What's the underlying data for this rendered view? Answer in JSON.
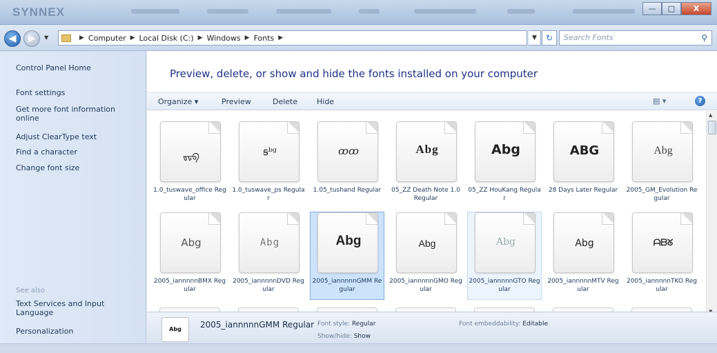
{
  "window": {
    "brand": "SYNNEX",
    "controls": {
      "minimize": "—",
      "maximize": "□",
      "close": "X"
    }
  },
  "nav": {
    "back_glyph": "◀",
    "forward_glyph": "▶",
    "breadcrumb": [
      "Computer",
      "Local Disk (C:)",
      "Windows",
      "Fonts"
    ],
    "search_placeholder": "Search Fonts"
  },
  "left_pane": {
    "links": [
      "Control Panel Home",
      "Font settings",
      "Get more font information online",
      "Adjust ClearType text",
      "Find a character",
      "Change font size"
    ],
    "see_also_heading": "See also",
    "see_also": [
      "Text Services and Input Language",
      "Personalization"
    ]
  },
  "main": {
    "heading": "Preview, delete, or show and hide the fonts installed on your computer",
    "commands": {
      "organize": "Organize ▾",
      "preview": "Preview",
      "delete": "Delete",
      "hide": "Hide"
    },
    "view_glyph": "▤ ▾",
    "help_glyph": "?"
  },
  "fonts": [
    {
      "sample": "ᢐᢑᢒ",
      "label": "1.0_tuswave_office Regular"
    },
    {
      "sample": "ꞩᵇᵍ",
      "label": "1.0_tuswave_ps Regular"
    },
    {
      "sample": "ꝏꝏ",
      "label": "1.05_tushand Regular"
    },
    {
      "sample": "Abg",
      "label": "05_ZZ Death Note 1.0 Regular"
    },
    {
      "sample": "Abg",
      "label": "05_ZZ HouKang Regular"
    },
    {
      "sample": "ABG",
      "label": "28 Days Later Regular"
    },
    {
      "sample": "Abg",
      "label": "2005_GM_Evolution Regular"
    },
    {
      "sample": "Abg",
      "label": "2005_iannnnnBMX Regular"
    },
    {
      "sample": "Abg",
      "label": "2005_iannnnnDVD Regular"
    },
    {
      "sample": "Abg",
      "label": "2005_iannnnnGMM Regular"
    },
    {
      "sample": "Abg",
      "label": "2005_iannnnnGMO Regular"
    },
    {
      "sample": "Abg",
      "label": "2005_iannnnnGTO Regular"
    },
    {
      "sample": "Abg",
      "label": "2005_iannnnnMTV Regular"
    },
    {
      "sample": "ᗩᗷᘜ",
      "label": "2005_iannnnnTKO Regular"
    }
  ],
  "details": {
    "thumb_sample": "Abg",
    "name": "2005_iannnnnGMM Regular",
    "font_style_label": "Font style:",
    "font_style_value": "Regular",
    "show_hide_label": "Show/hide:",
    "show_hide_value": "Show",
    "embeddability_label": "Font embeddability:",
    "embeddability_value": "Editable"
  }
}
